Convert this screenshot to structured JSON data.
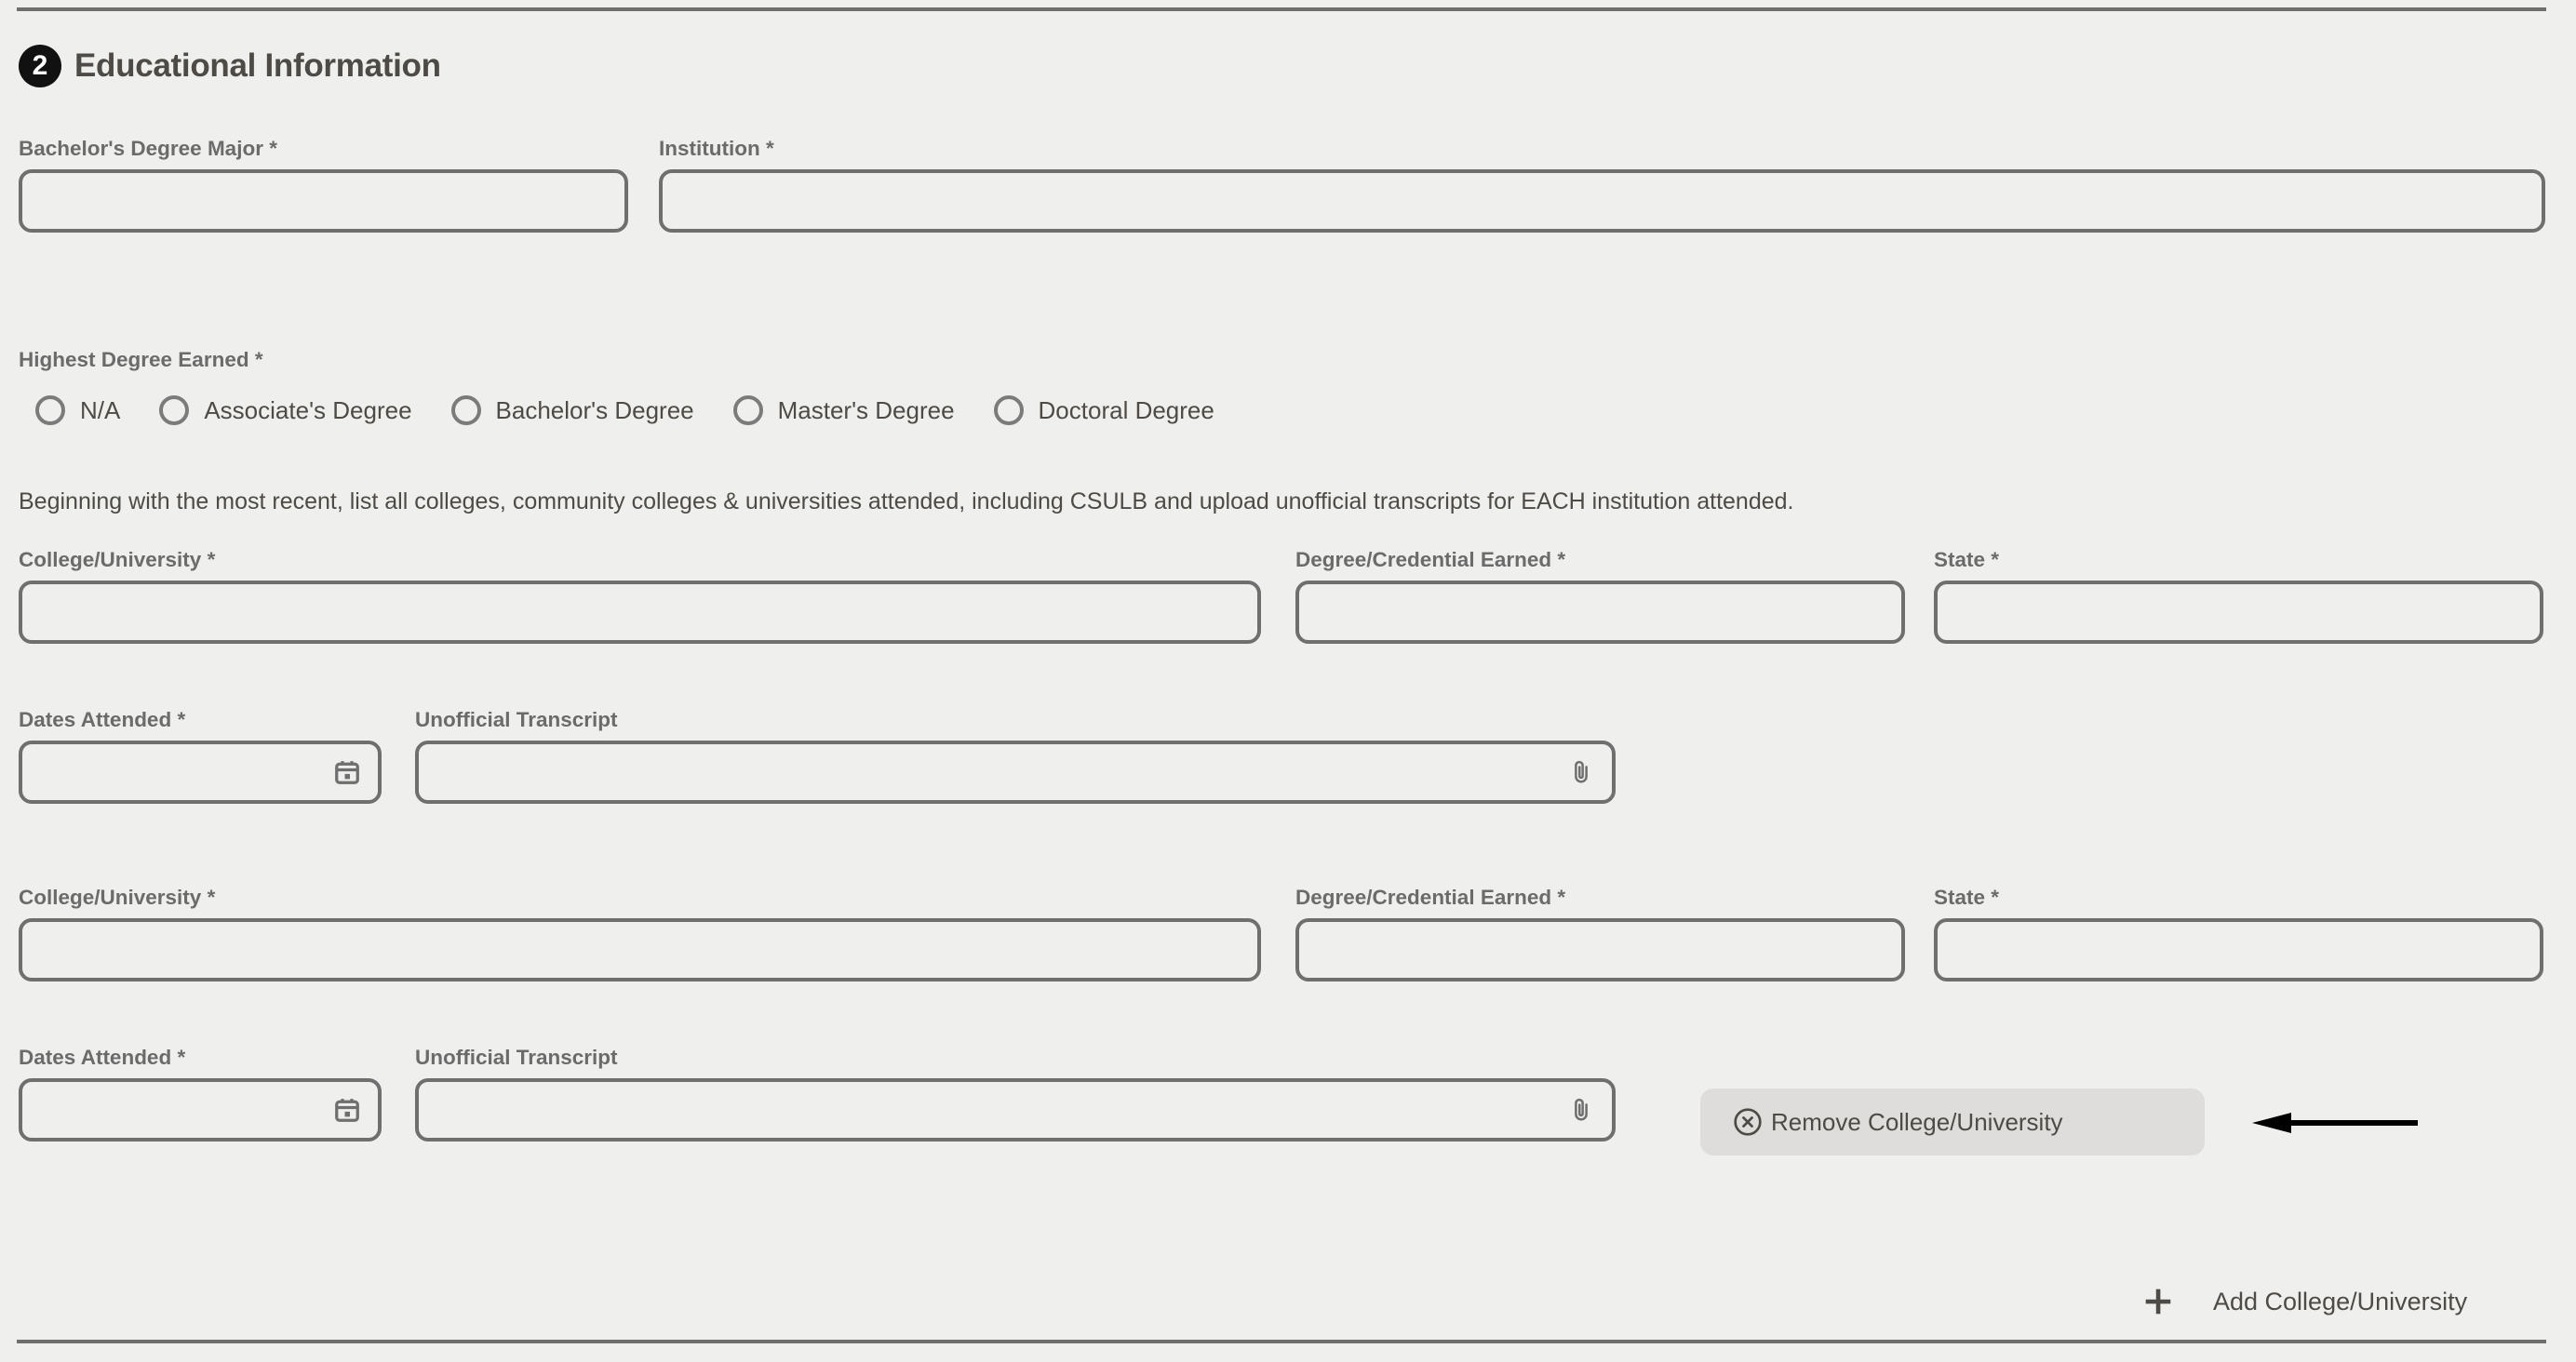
{
  "section": {
    "step_number": "2",
    "title": "Educational Information"
  },
  "top_fields": [
    {
      "label": "Bachelor's Degree Major *",
      "value": "",
      "placeholder": ""
    },
    {
      "label": "Institution *",
      "value": "",
      "placeholder": ""
    }
  ],
  "highest_degree": {
    "label": "Highest Degree Earned *",
    "options": [
      {
        "label": "N/A",
        "selected": false
      },
      {
        "label": "Associate's Degree",
        "selected": false
      },
      {
        "label": "Bachelor's Degree",
        "selected": false
      },
      {
        "label": "Master's Degree",
        "selected": false
      },
      {
        "label": "Doctoral Degree",
        "selected": false
      }
    ]
  },
  "instruction": "Beginning with the most recent, list all colleges, community colleges & universities attended, including CSULB and upload unofficial transcripts for EACH institution attended.",
  "entries": [
    {
      "college_label": "College/University *",
      "college_value": "",
      "degree_label": "Degree/Credential Earned *",
      "degree_value": "",
      "state_label": "State *",
      "state_value": "",
      "dates_label": "Dates Attended *",
      "dates_value": "",
      "dates_icon": "calendar-icon",
      "transcript_label": "Unofficial Transcript",
      "transcript_value": "",
      "transcript_icon": "paperclip-icon",
      "remove_label": null
    },
    {
      "college_label": "College/University *",
      "college_value": "",
      "degree_label": "Degree/Credential Earned *",
      "degree_value": "",
      "state_label": "State *",
      "state_value": "",
      "dates_label": "Dates Attended *",
      "dates_value": "",
      "dates_icon": "calendar-icon",
      "transcript_label": "Unofficial Transcript",
      "transcript_value": "",
      "transcript_icon": "paperclip-icon",
      "remove_label": "Remove College/University"
    }
  ],
  "add_entry": {
    "label": "Add College/University",
    "icon": "plus-icon"
  },
  "annotation": {
    "type": "left-arrow",
    "color": "#000000"
  },
  "colors": {
    "page_background": "#efefed",
    "border": "#6f6f6f",
    "label_text": "#6b6b6b",
    "body_text": "#4e4b46",
    "badge_background": "#111111",
    "button_background": "#dedddb"
  }
}
